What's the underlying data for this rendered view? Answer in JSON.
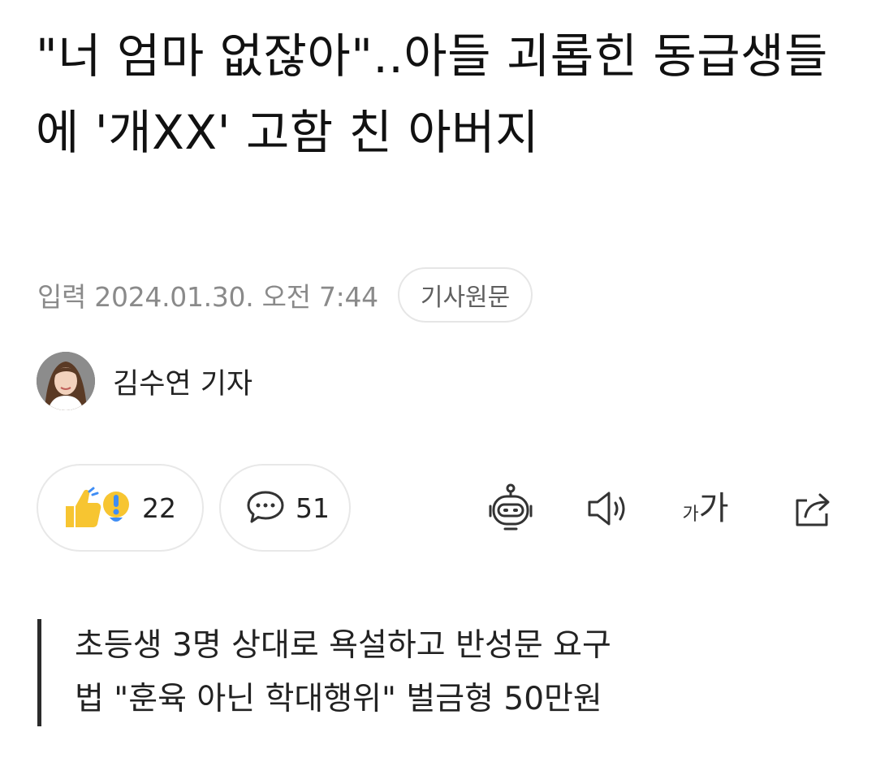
{
  "article": {
    "title": "\"너 엄마 없잖아\"..아들 괴롭힌 동급생들에 '개XX' 고함 친 아버지",
    "date": "입력 2024.01.30. 오전 7:44",
    "source_label": "기사원문",
    "author": "김수연 기자"
  },
  "reactions": {
    "like_count": "22",
    "comment_count": "51"
  },
  "toolbar": {
    "font_small": "가",
    "font_large": "가"
  },
  "subtitle": {
    "lines": [
      "초등생 3명 상대로 욕설하고 반성문 요구",
      "법 \"훈육 아닌 학대행위\" 벌금형 50만원"
    ]
  },
  "colors": {
    "text": "#111111",
    "meta": "#8a8a8a",
    "border": "#e6e6e6",
    "reaction_yellow": "#f7c531",
    "reaction_blue": "#3f8df5"
  }
}
